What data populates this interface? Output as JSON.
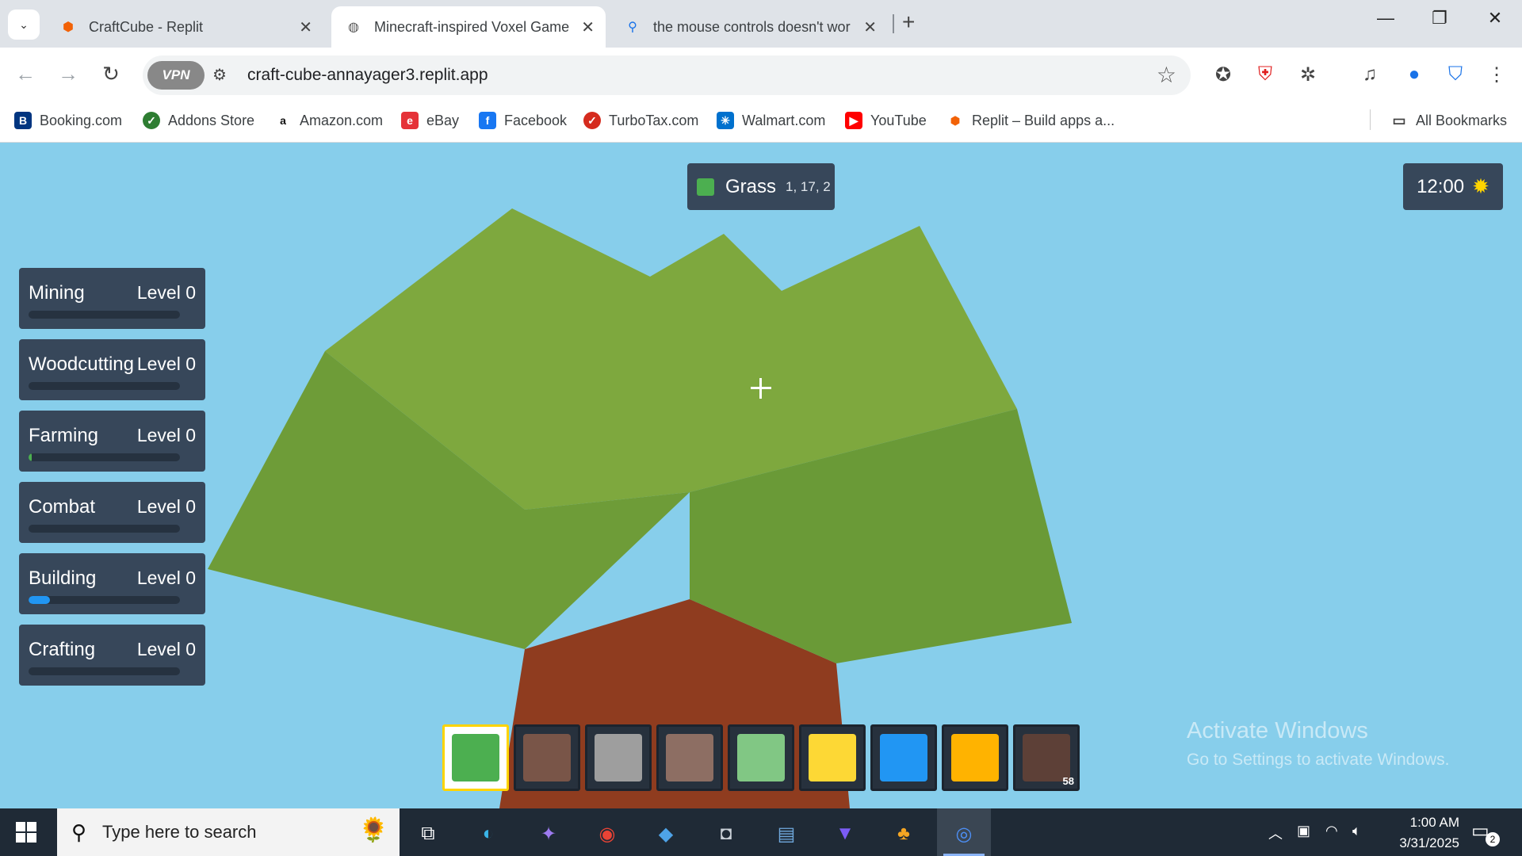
{
  "browser": {
    "tabs": [
      {
        "title": "CraftCube - Replit",
        "icon": "replit-icon"
      },
      {
        "title": "Minecraft-inspired Voxel Game",
        "icon": "globe-icon"
      },
      {
        "title": "the mouse controls doesn't wor",
        "icon": "search-icon"
      }
    ],
    "vpn_label": "VPN",
    "url": "craft-cube-annayager3.replit.app",
    "bookmarks": [
      "Booking.com",
      "Addons Store",
      "Amazon.com",
      "eBay",
      "Facebook",
      "TurboTax.com",
      "Walmart.com",
      "YouTube",
      "Replit – Build apps a..."
    ],
    "all_bookmarks": "All Bookmarks"
  },
  "game": {
    "block_info": {
      "name": "Grass",
      "coords": "1, 17, 2",
      "color": "#4caf50"
    },
    "time": "12:00",
    "skills": [
      {
        "name": "Mining",
        "level": "Level 0",
        "progress": 0,
        "color": "#4caf50"
      },
      {
        "name": "Woodcutting",
        "level": "Level 0",
        "progress": 0,
        "color": "#4caf50"
      },
      {
        "name": "Farming",
        "level": "Level 0",
        "progress": 0.02,
        "color": "#4caf50"
      },
      {
        "name": "Combat",
        "level": "Level 0",
        "progress": 0,
        "color": "#4caf50"
      },
      {
        "name": "Building",
        "level": "Level 0",
        "progress": 0.14,
        "color": "#2196f3"
      },
      {
        "name": "Crafting",
        "level": "Level 0",
        "progress": 0,
        "color": "#4caf50"
      }
    ],
    "hotbar": [
      {
        "color": "#4caf50",
        "selected": true
      },
      {
        "color": "#795548"
      },
      {
        "color": "#9e9e9e"
      },
      {
        "color": "#8d6e63"
      },
      {
        "color": "#81c784"
      },
      {
        "color": "#fdd835"
      },
      {
        "color": "#2196f3"
      },
      {
        "color": "#ffb300"
      },
      {
        "color": "#5d4037",
        "count": "58"
      }
    ],
    "colors": {
      "sky": "#87ceeb",
      "leaves": "#7cab3e",
      "trunk": "#8f3c1f"
    }
  },
  "watermark": {
    "title": "Activate Windows",
    "subtitle": "Go to Settings to activate Windows."
  },
  "taskbar": {
    "search_placeholder": "Type here to search",
    "time": "1:00 AM",
    "date": "3/31/2025",
    "notifications": "2"
  }
}
